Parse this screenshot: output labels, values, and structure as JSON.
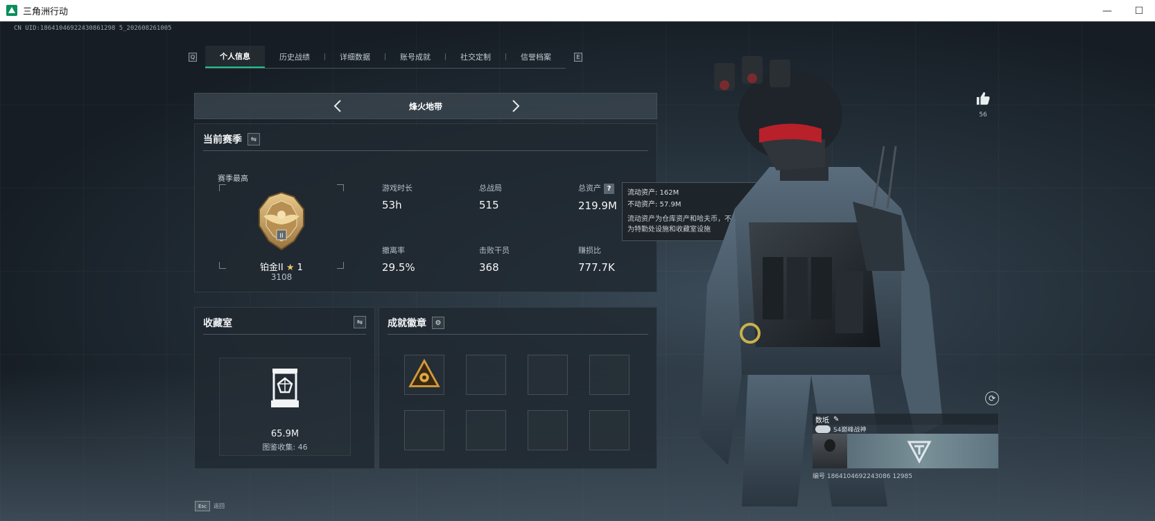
{
  "window": {
    "title": "三角洲行动",
    "min_label": "—",
    "max_label": "☐"
  },
  "uid_text": "CN UID:18641046922430861298 5_202608261005",
  "tabs": {
    "left_key": "Q",
    "right_key": "E",
    "items": [
      {
        "label": "个人信息",
        "active": true
      },
      {
        "label": "历史战绩"
      },
      {
        "label": "详细数据"
      },
      {
        "label": "账号成就"
      },
      {
        "label": "社交定制"
      },
      {
        "label": "信誉档案"
      }
    ]
  },
  "mode": {
    "title": "烽火地带"
  },
  "season_panel": {
    "title": "当前赛季",
    "best_label": "赛季最高",
    "rank_name": "铂金II",
    "rank_stars": "1",
    "rank_score": "3108",
    "stats": [
      {
        "label": "游戏时长",
        "value": "53h"
      },
      {
        "label": "总战局",
        "value": "515"
      },
      {
        "label": "总资产",
        "value": "219.9M",
        "help": "?"
      },
      {
        "label": "撤离率",
        "value": "29.5%"
      },
      {
        "label": "击败干员",
        "value": "368"
      },
      {
        "label": "赚损比",
        "value": "777.7K"
      }
    ]
  },
  "tooltip": {
    "liquid": "流动资产: 162M",
    "fixed": "不动资产: 57.9M",
    "desc_line1": "流动资产为仓库资产和哈夫币，不动资产",
    "desc_line2": "为特勤处设施和收藏室设施"
  },
  "collection_panel": {
    "title": "收藏室",
    "value": "65.9M",
    "count_text": "图鉴收集: 46"
  },
  "badges_panel": {
    "title": "成就徽章"
  },
  "likes": {
    "count": "56"
  },
  "name_card": {
    "name": "数坻",
    "title_text": "S4巅峰战神",
    "id_text": "编号 1864104692243086 12985"
  },
  "esc": {
    "key": "Esc",
    "label": "返回"
  },
  "colors": {
    "accent": "#19c38a",
    "rank_gold": "#c9a25a"
  }
}
